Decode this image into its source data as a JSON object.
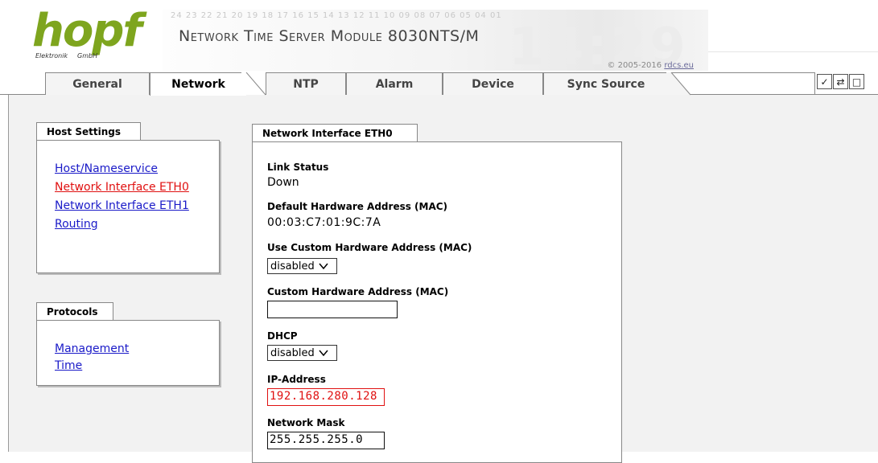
{
  "header": {
    "logo_text": "hopf",
    "logo_sub_left": "Elektronik",
    "logo_sub_right": "GmbH",
    "banner_digits": "24 23 22 21 20 19 18 17 16 15 14 13 12 11 10 09 08 07 06 05 04 01",
    "banner_bigclock": "14:29",
    "title": "Network Time Server Module 8030NTS/M",
    "copyright_prefix": "© 2005-2016 ",
    "copyright_link": "rdcs.eu"
  },
  "tabs": [
    {
      "label": "General",
      "active": false
    },
    {
      "label": "Network",
      "active": true
    },
    {
      "label": "NTP",
      "active": false
    },
    {
      "label": "Alarm",
      "active": false
    },
    {
      "label": "Device",
      "active": false
    },
    {
      "label": "Sync Source",
      "active": false
    }
  ],
  "toolbar": {
    "icons": [
      "check-icon",
      "refresh-icon",
      "window-icon"
    ],
    "check_glyph": "✓",
    "refresh_glyph": "⇄",
    "window_glyph": "□"
  },
  "sidebar": {
    "host_settings": {
      "title": "Host Settings",
      "items": [
        {
          "label": "Host/Nameservice",
          "current": false
        },
        {
          "label": "Network Interface ETH0",
          "current": true
        },
        {
          "label": "Network Interface ETH1",
          "current": false
        },
        {
          "label": "Routing",
          "current": false
        }
      ]
    },
    "protocols": {
      "title": "Protocols",
      "items": [
        {
          "label": "Management",
          "current": false
        },
        {
          "label": "Time",
          "current": false
        }
      ]
    }
  },
  "form": {
    "title": "Network Interface ETH0",
    "link_status": {
      "label": "Link Status",
      "value": "Down"
    },
    "default_mac": {
      "label": "Default Hardware Address (MAC)",
      "value": "00:03:C7:01:9C:7A"
    },
    "use_custom_mac": {
      "label": "Use Custom Hardware Address (MAC)",
      "value": "disabled"
    },
    "custom_mac": {
      "label": "Custom Hardware Address (MAC)",
      "value": ""
    },
    "dhcp": {
      "label": "DHCP",
      "value": "disabled"
    },
    "ip_address": {
      "label": "IP-Address",
      "value": "192.168.280.128",
      "error_color": "#e01010"
    },
    "network_mask": {
      "label": "Network Mask",
      "value": "255.255.255.0"
    }
  },
  "colors": {
    "logo_green": "#7ea51e",
    "link_blue": "#1a1ac8",
    "link_active_red": "#e01010",
    "content_bg": "#f2f2f2"
  }
}
